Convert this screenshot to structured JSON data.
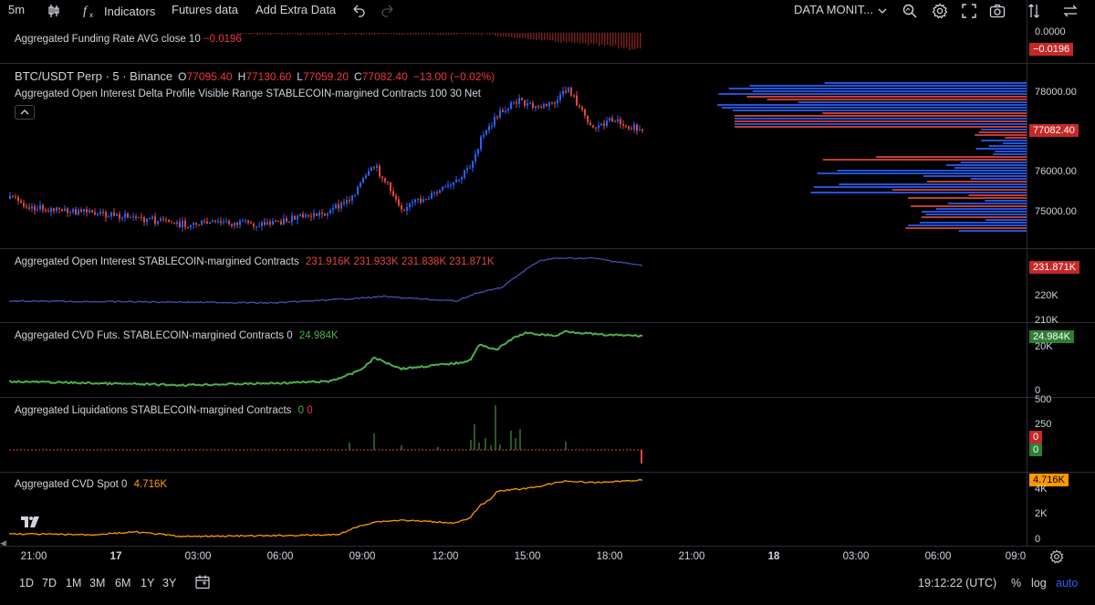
{
  "toolbar": {
    "interval": "5m",
    "indicators": "Indicators",
    "futures_data": "Futures data",
    "add_extra_data": "Add Extra Data",
    "layout_name": "DATA MONIT..."
  },
  "funding": {
    "label": "Aggregated Funding Rate AVG close 10",
    "value": "−0.0196",
    "scale_top": "0.0000",
    "badge": "−0.0196"
  },
  "main": {
    "symbol": "BTC/USDT Perp · 5 · Binance",
    "o_key": "O",
    "o_val": "77095.40",
    "h_key": "H",
    "h_val": "77130.60",
    "l_key": "L",
    "l_val": "77059.20",
    "c_key": "C",
    "c_val": "77082.40",
    "change": "−13.00 (−0.02%)",
    "profile_label": "Aggregated Open Interest Delta Profile Visible Range STABLECOIN-margined Contracts 100 30 Net",
    "scale": [
      "78000.00",
      "76000.00",
      "75000.00"
    ],
    "badge": "77082.40"
  },
  "oi": {
    "label": "Aggregated Open Interest STABLECOIN-margined Contracts",
    "v1": "231.916K",
    "v2": "231.933K",
    "v3": "231.838K",
    "v4": "231.871K",
    "badge": "231.871K",
    "scale": [
      "220K",
      "210K"
    ]
  },
  "cvd_futs": {
    "label": "Aggregated CVD Futs. STABLECOIN-margined Contracts 0",
    "value": "24.984K",
    "badge": "24.984K",
    "scale": [
      "20K",
      "0"
    ]
  },
  "liq": {
    "label": "Aggregated Liquidations STABLECOIN-margined Contracts",
    "v1": "0",
    "v2": "0",
    "scale": [
      "500",
      "250"
    ],
    "badge_red": "0",
    "badge_green": "0"
  },
  "cvd_spot": {
    "label": "Aggregated CVD Spot 0",
    "value": "4.716K",
    "badge": "4.716K",
    "scale": [
      "4K",
      "2K",
      "0"
    ]
  },
  "time_axis": [
    "21:00",
    "17",
    "03:00",
    "06:00",
    "09:00",
    "12:00",
    "15:00",
    "18:00",
    "21:00",
    "18",
    "03:00",
    "06:00",
    "09:0"
  ],
  "bottom": {
    "ranges": [
      "1D",
      "7D",
      "1M",
      "3M",
      "6M",
      "1Y",
      "3Y"
    ],
    "clock": "19:12:22 (UTC)",
    "percent": "%",
    "log": "log",
    "auto": "auto"
  },
  "colors": {
    "up": "#2962ff",
    "down": "#e2473f",
    "cvd_futs": "#4caf50",
    "cvd_spot": "#ff9800",
    "background": "#000000"
  },
  "icons": [
    "indicators-icon",
    "candles-icon",
    "undo-icon",
    "redo-icon",
    "chevron-down-icon",
    "search-icon",
    "gear-icon",
    "fullscreen-icon",
    "camera-icon",
    "compare-icon",
    "swap-icon",
    "calendar-icon",
    "settings-icon",
    "tradingview-logo"
  ]
}
